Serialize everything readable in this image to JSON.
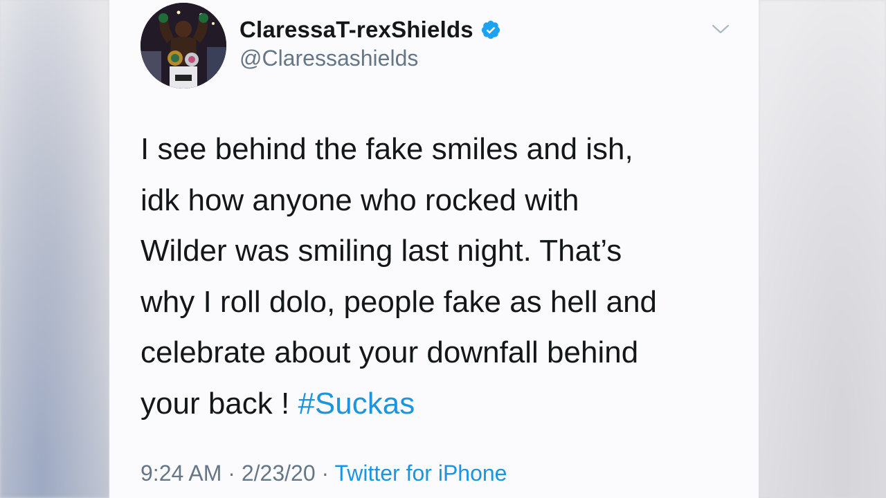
{
  "author": {
    "display_name": "ClaressaT-rexShields",
    "handle": "@Claressashields",
    "verified": true
  },
  "tweet": {
    "lines": [
      "I see behind the fake smiles and ish,",
      "idk how anyone who rocked with",
      "Wilder was smiling last night. That’s",
      "why I roll dolo, people fake as hell and",
      "celebrate about your downfall behind",
      "your back ! "
    ],
    "hashtag": "#Suckas"
  },
  "meta": {
    "time": "9:24 AM",
    "separator": " · ",
    "date": "2/23/20",
    "source": "Twitter for iPhone"
  },
  "icons": {
    "verified": "verified-badge-icon",
    "more": "chevron-down-icon"
  },
  "colors": {
    "link": "#1b95e0",
    "text": "#14171a",
    "secondary": "#657786",
    "verified": "#1da1f2"
  }
}
